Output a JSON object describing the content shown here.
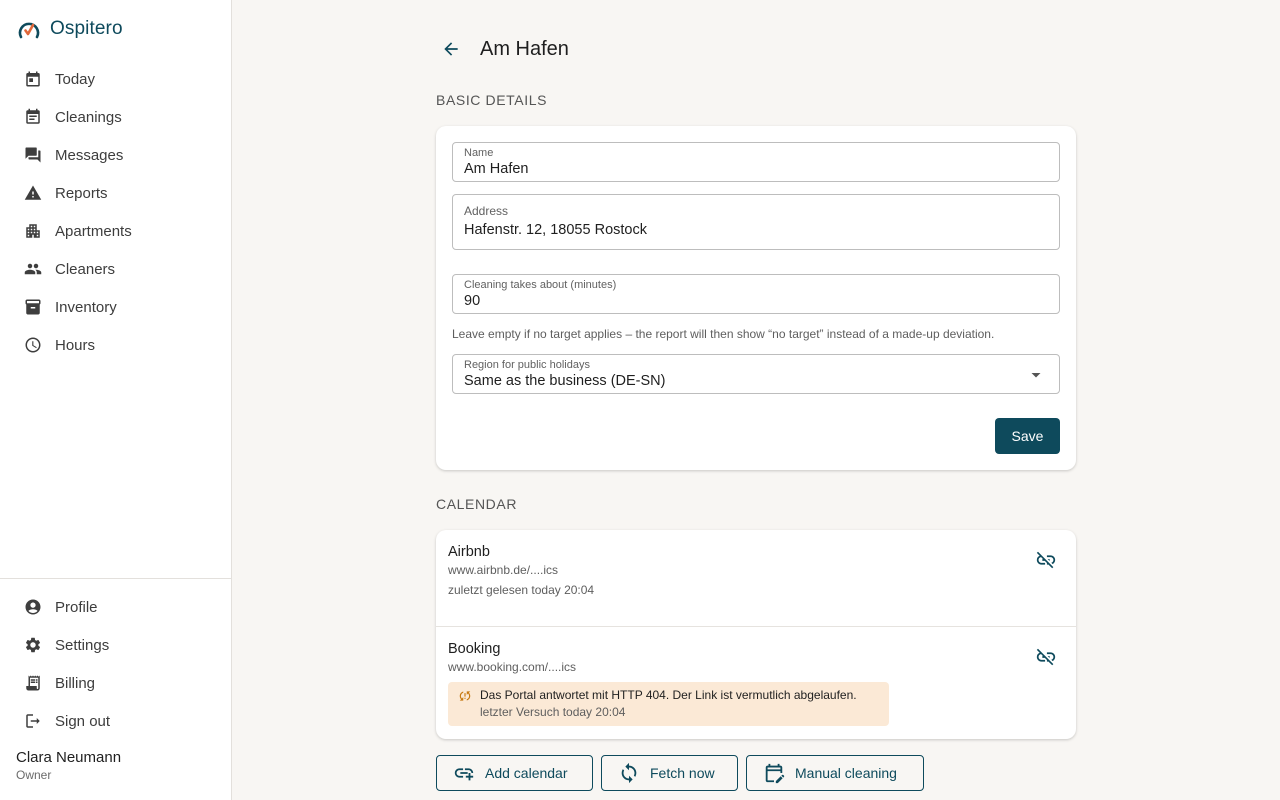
{
  "app": {
    "name": "Ospitero",
    "accent": "#0e4a5c"
  },
  "sidebar": {
    "items": [
      {
        "label": "Today",
        "icon": "calendar-today-icon"
      },
      {
        "label": "Cleanings",
        "icon": "event-note-icon"
      },
      {
        "label": "Messages",
        "icon": "chat-icon"
      },
      {
        "label": "Reports",
        "icon": "warning-icon"
      },
      {
        "label": "Apartments",
        "icon": "apartment-icon"
      },
      {
        "label": "Cleaners",
        "icon": "people-icon"
      },
      {
        "label": "Inventory",
        "icon": "archive-icon"
      },
      {
        "label": "Hours",
        "icon": "clock-icon"
      }
    ],
    "bottom_items": [
      {
        "label": "Profile",
        "icon": "account-circle-icon"
      },
      {
        "label": "Settings",
        "icon": "gear-icon"
      },
      {
        "label": "Billing",
        "icon": "receipt-icon"
      },
      {
        "label": "Sign out",
        "icon": "logout-icon"
      }
    ],
    "user": {
      "name": "Clara Neumann",
      "role": "Owner"
    }
  },
  "page": {
    "title": "Am Hafen"
  },
  "basic_details": {
    "section_title": "BASIC DETAILS",
    "name_label": "Name",
    "name_value": "Am Hafen",
    "address_label": "Address",
    "address_value": "Hafenstr. 12, 18055 Rostock",
    "duration_label": "Cleaning takes about (minutes)",
    "duration_value": "90",
    "duration_helper": "Leave empty if no target applies – the report will then show “no target” instead of a made-up deviation.",
    "region_label": "Region for public holidays",
    "region_value": "Same as the business (DE-SN)",
    "save_label": "Save"
  },
  "calendar": {
    "section_title": "CALENDAR",
    "items": [
      {
        "name": "Airbnb",
        "url": "www.airbnb.de/....ics",
        "status": "zuletzt gelesen today 20:04"
      },
      {
        "name": "Booking",
        "url": "www.booking.com/....ics",
        "error": "Das Portal antwortet mit HTTP 404. Der Link ist vermutlich abgelaufen.",
        "last_attempt": "letzter Versuch today 20:04"
      }
    ],
    "warning_color": "#fbe9d6",
    "actions": {
      "add_label": "Add calendar",
      "fetch_label": "Fetch now",
      "manual_label": "Manual cleaning"
    }
  }
}
